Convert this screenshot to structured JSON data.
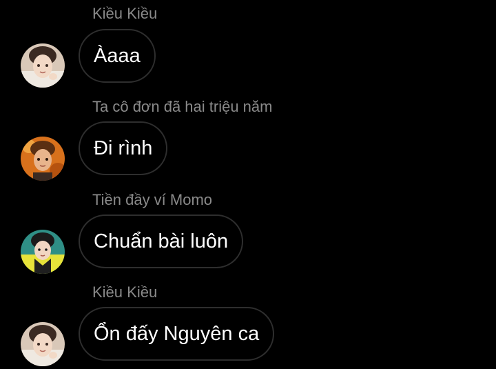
{
  "messages": [
    {
      "sender": "Kiều Kiều",
      "text": "Àaaa",
      "avatar": "avatar-kieu-kieu"
    },
    {
      "sender": "Ta cô đơn đã hai triệu năm",
      "text": "Đi rình",
      "avatar": "avatar-orange-boy"
    },
    {
      "sender": "Tiền đầy ví Momo",
      "text": "Chuẩn bài luôn",
      "avatar": "avatar-yellow-shirt"
    },
    {
      "sender": "Kiều Kiều",
      "text": "Ổn đấy Nguyên ca",
      "avatar": "avatar-kieu-kieu"
    }
  ]
}
